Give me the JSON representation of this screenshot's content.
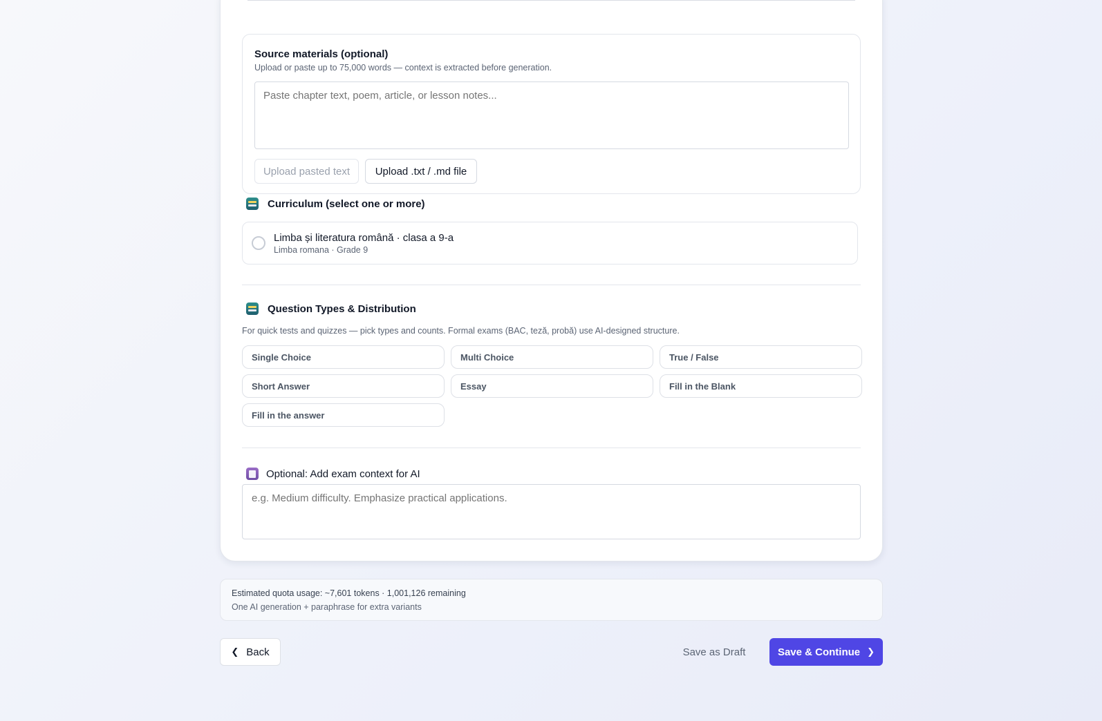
{
  "source": {
    "title": "Source materials (optional)",
    "subtitle": "Upload or paste up to 75,000 words — context is extracted before generation.",
    "placeholder": "Paste chapter text, poem, article, or lesson notes...",
    "value": "",
    "upload_pasted_label": "Upload pasted text",
    "upload_file_label": "Upload .txt / .md file"
  },
  "curriculum": {
    "icon": "books-icon",
    "title": "Curriculum (select one or more)",
    "items": [
      {
        "title": "Limba și literatura română · clasa a 9-a",
        "subtitle": "Limba romana · Grade 9",
        "selected": false
      }
    ]
  },
  "question_types": {
    "icon": "books-icon",
    "title": "Question Types & Distribution",
    "description": "For quick tests and quizzes — pick types and counts. Formal exams (BAC, teză, probă) use AI-designed structure.",
    "items": [
      "Single Choice",
      "Multi Choice",
      "True / False",
      "Short Answer",
      "Essay",
      "Fill in the Blank",
      "Fill in the answer"
    ]
  },
  "context": {
    "icon": "memo-icon",
    "title": "Optional: Add exam context for AI",
    "placeholder": "e.g. Medium difficulty. Emphasize practical applications.",
    "value": ""
  },
  "quota": {
    "line1": "Estimated quota usage: ~7,601 tokens · 1,001,126 remaining",
    "line2": "One AI generation + paraphrase for extra variants"
  },
  "footer": {
    "back_label": "Back",
    "draft_label": "Save as Draft",
    "continue_label": "Save & Continue"
  },
  "colors": {
    "primary": "#4f46e5",
    "border": "#e3e6ec",
    "muted_text": "#5b6474"
  }
}
